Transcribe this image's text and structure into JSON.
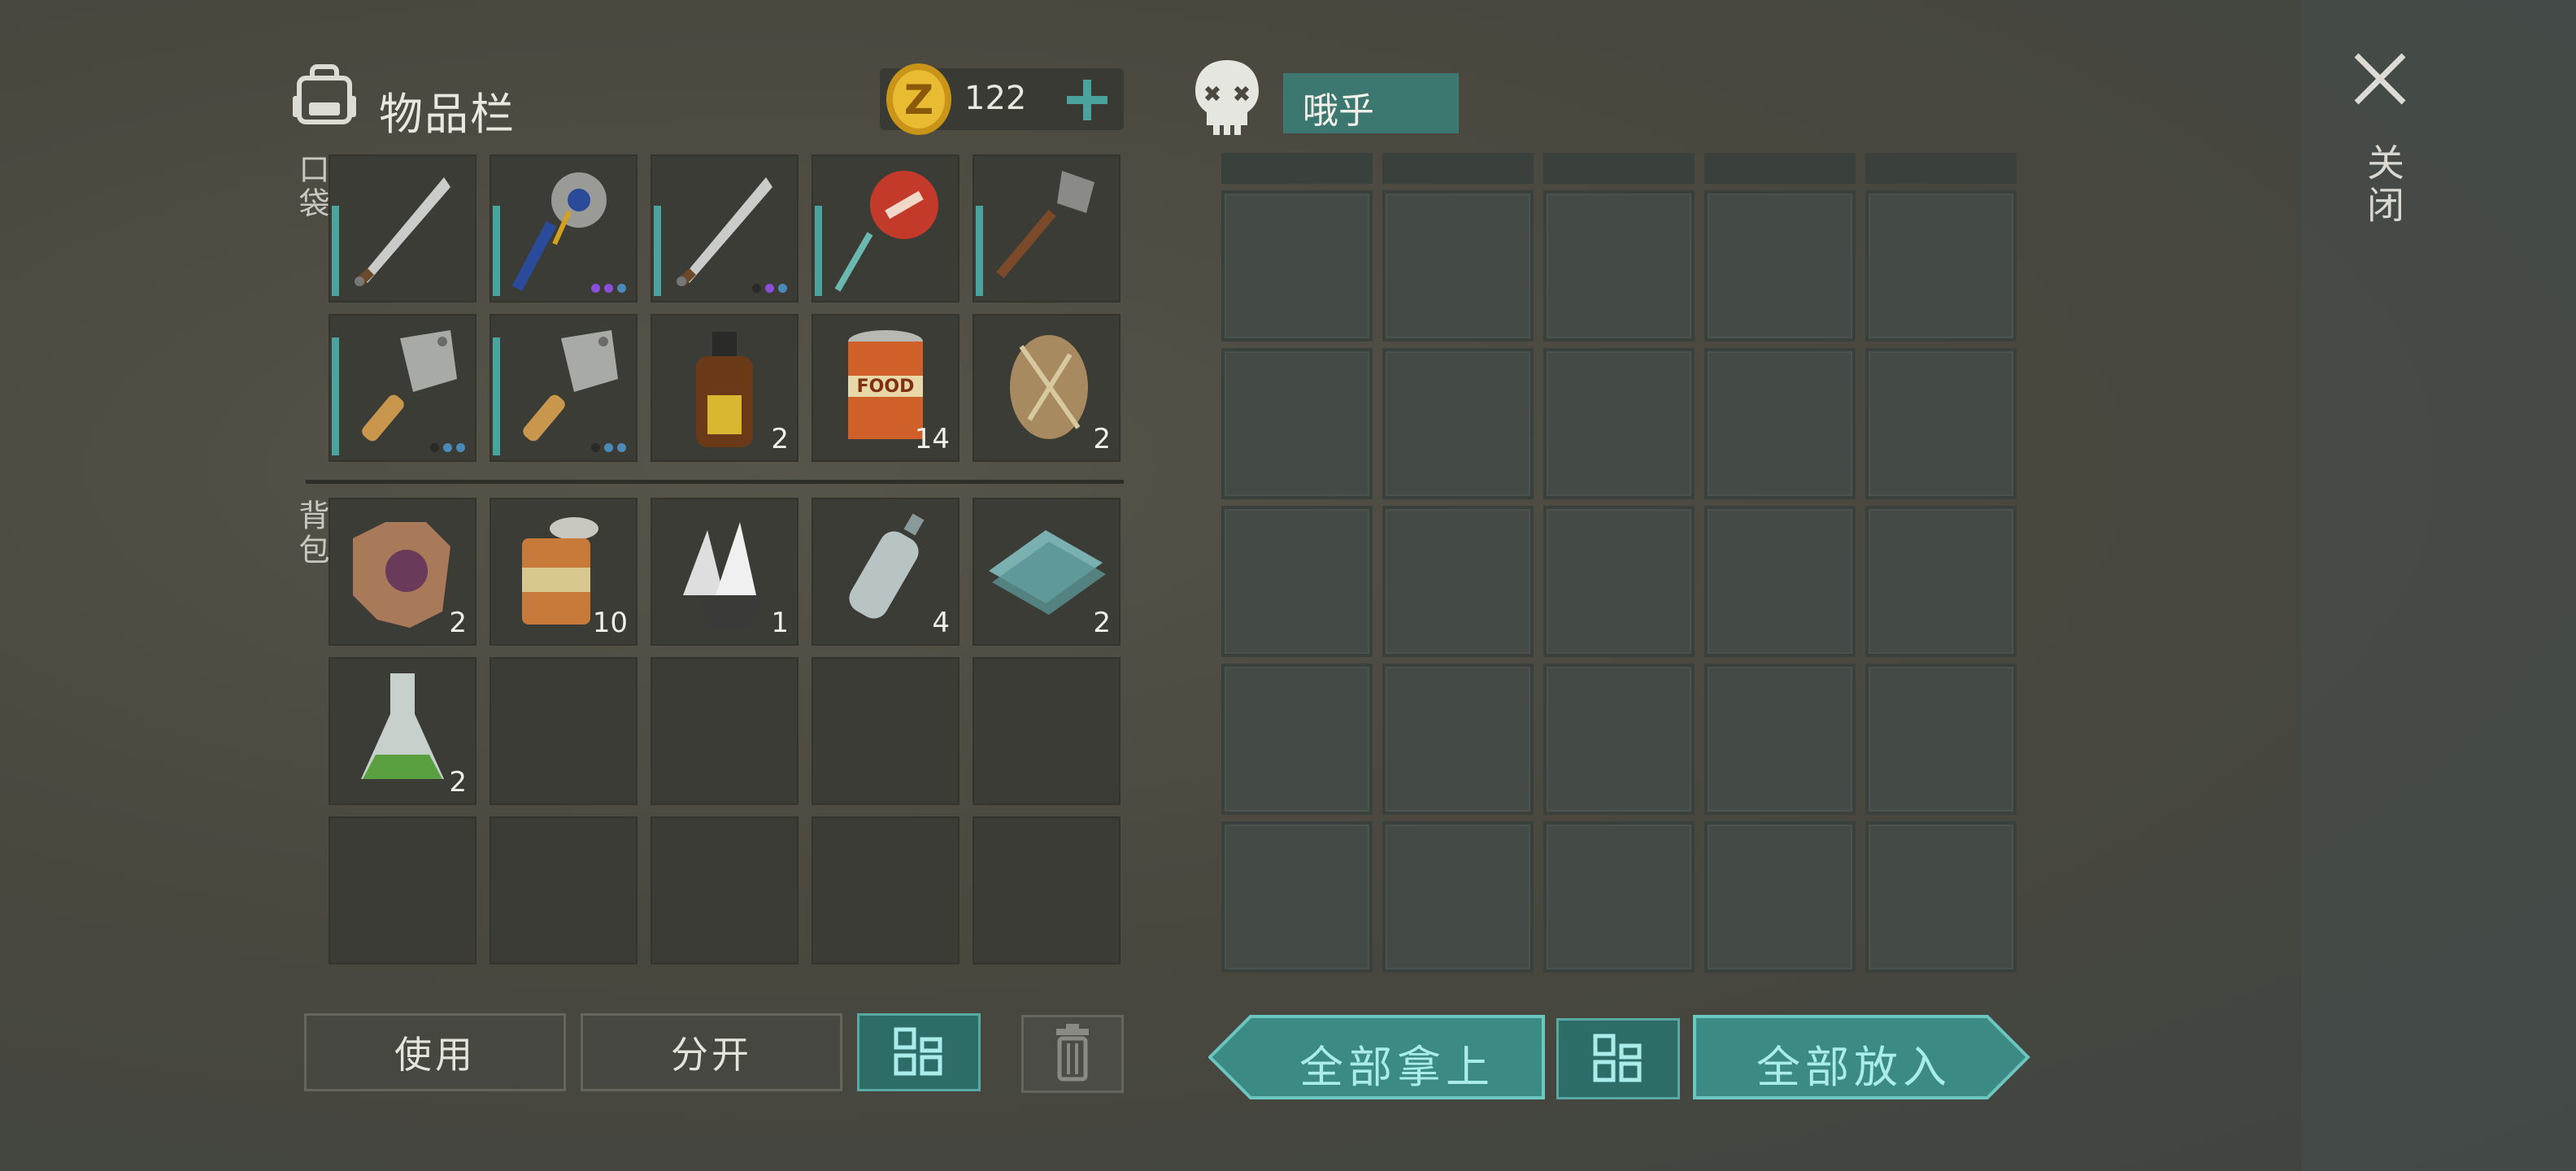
{
  "inventory": {
    "title": "物品栏",
    "coins": "122",
    "pocket_label": "口袋",
    "backpack_label": "背包",
    "pocket_slots": [
      {
        "icon": "machete-icon",
        "durability": 0.65,
        "qty": "",
        "dots": []
      },
      {
        "icon": "sawblade-mace-icon",
        "durability": 0.65,
        "qty": "",
        "dots": [
          "purple",
          "purple",
          "blue"
        ]
      },
      {
        "icon": "machete-icon",
        "durability": 0.65,
        "qty": "",
        "dots": [
          "dark",
          "purple",
          "blue"
        ]
      },
      {
        "icon": "stop-sign-icon",
        "durability": 0.65,
        "qty": "",
        "dots": []
      },
      {
        "icon": "shovel-icon",
        "durability": 0.65,
        "qty": "",
        "dots": []
      },
      {
        "icon": "cleaver-icon",
        "durability": 0.85,
        "qty": "",
        "dots": [
          "dark",
          "blue",
          "blue"
        ]
      },
      {
        "icon": "cleaver-icon",
        "durability": 0.85,
        "qty": "",
        "dots": [
          "dark",
          "blue",
          "blue"
        ]
      },
      {
        "icon": "bottle-icon",
        "durability": null,
        "qty": "2",
        "dots": []
      },
      {
        "icon": "canned-food-icon",
        "durability": null,
        "qty": "14",
        "dots": []
      },
      {
        "icon": "fur-icon",
        "durability": null,
        "qty": "2",
        "dots": []
      }
    ],
    "backpack_slots": [
      {
        "icon": "hide-icon",
        "qty": "2"
      },
      {
        "icon": "tin-can-icon",
        "qty": "10"
      },
      {
        "icon": "crystal-icon",
        "qty": "1"
      },
      {
        "icon": "plastic-bottle-icon",
        "qty": "4"
      },
      {
        "icon": "glass-icon",
        "qty": "2"
      },
      {
        "icon": "flask-icon",
        "qty": "2"
      },
      {
        "icon": "",
        "qty": ""
      },
      {
        "icon": "",
        "qty": ""
      },
      {
        "icon": "",
        "qty": ""
      },
      {
        "icon": "",
        "qty": ""
      },
      {
        "icon": "",
        "qty": ""
      },
      {
        "icon": "",
        "qty": ""
      },
      {
        "icon": "",
        "qty": ""
      },
      {
        "icon": "",
        "qty": ""
      },
      {
        "icon": "",
        "qty": ""
      }
    ]
  },
  "container": {
    "name": "哦乎",
    "icon": "skull-icon"
  },
  "buttons": {
    "use": "使用",
    "split": "分开",
    "take_all": "全部拿上",
    "put_all": "全部放入"
  },
  "close_label": "关闭",
  "colors": {
    "accent_teal": "#3d7870",
    "durability": "#4aa39d",
    "coin_gold": "#e0b030"
  }
}
